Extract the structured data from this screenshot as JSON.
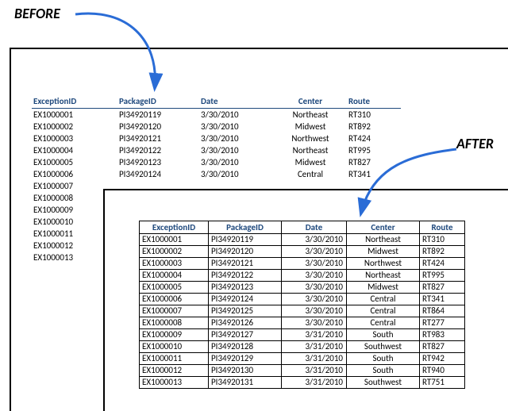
{
  "labels": {
    "before": "BEFORE",
    "after": "AFTER"
  },
  "columns": {
    "exception": "ExceptionID",
    "package": "PackageID",
    "date": "Date",
    "center": "Center",
    "route": "Route"
  },
  "before_rows": [
    {
      "exc": "EX1000001",
      "pkg": "PI34920119",
      "date": "3/30/2010",
      "ctr": "Northeast",
      "rt": "RT310"
    },
    {
      "exc": "EX1000002",
      "pkg": "PI34920120",
      "date": "3/30/2010",
      "ctr": "Midwest",
      "rt": "RT892"
    },
    {
      "exc": "EX1000003",
      "pkg": "PI34920121",
      "date": "3/30/2010",
      "ctr": "Northwest",
      "rt": "RT424"
    },
    {
      "exc": "EX1000004",
      "pkg": "PI34920122",
      "date": "3/30/2010",
      "ctr": "Northeast",
      "rt": "RT995"
    },
    {
      "exc": "EX1000005",
      "pkg": "PI34920123",
      "date": "3/30/2010",
      "ctr": "Midwest",
      "rt": "RT827"
    },
    {
      "exc": "EX1000006",
      "pkg": "PI34920124",
      "date": "3/30/2010",
      "ctr": "Central",
      "rt": "RT341"
    },
    {
      "exc": "EX1000007",
      "pkg": "",
      "date": "",
      "ctr": "",
      "rt": ""
    },
    {
      "exc": "EX1000008",
      "pkg": "",
      "date": "",
      "ctr": "",
      "rt": ""
    },
    {
      "exc": "EX1000009",
      "pkg": "",
      "date": "",
      "ctr": "",
      "rt": ""
    },
    {
      "exc": "EX1000010",
      "pkg": "",
      "date": "",
      "ctr": "",
      "rt": ""
    },
    {
      "exc": "EX1000011",
      "pkg": "",
      "date": "",
      "ctr": "",
      "rt": ""
    },
    {
      "exc": "EX1000012",
      "pkg": "",
      "date": "",
      "ctr": "",
      "rt": ""
    },
    {
      "exc": "EX1000013",
      "pkg": "",
      "date": "",
      "ctr": "",
      "rt": ""
    }
  ],
  "after_rows": [
    {
      "exc": "EX1000001",
      "pkg": "PI34920119",
      "date": "3/30/2010",
      "ctr": "Northeast",
      "rt": "RT310"
    },
    {
      "exc": "EX1000002",
      "pkg": "PI34920120",
      "date": "3/30/2010",
      "ctr": "Midwest",
      "rt": "RT892"
    },
    {
      "exc": "EX1000003",
      "pkg": "PI34920121",
      "date": "3/30/2010",
      "ctr": "Northwest",
      "rt": "RT424"
    },
    {
      "exc": "EX1000004",
      "pkg": "PI34920122",
      "date": "3/30/2010",
      "ctr": "Northeast",
      "rt": "RT995"
    },
    {
      "exc": "EX1000005",
      "pkg": "PI34920123",
      "date": "3/30/2010",
      "ctr": "Midwest",
      "rt": "RT827"
    },
    {
      "exc": "EX1000006",
      "pkg": "PI34920124",
      "date": "3/30/2010",
      "ctr": "Central",
      "rt": "RT341"
    },
    {
      "exc": "EX1000007",
      "pkg": "PI34920125",
      "date": "3/30/2010",
      "ctr": "Central",
      "rt": "RT864"
    },
    {
      "exc": "EX1000008",
      "pkg": "PI34920126",
      "date": "3/30/2010",
      "ctr": "Central",
      "rt": "RT277"
    },
    {
      "exc": "EX1000009",
      "pkg": "PI34920127",
      "date": "3/31/2010",
      "ctr": "South",
      "rt": "RT983"
    },
    {
      "exc": "EX1000010",
      "pkg": "PI34920128",
      "date": "3/31/2010",
      "ctr": "Southwest",
      "rt": "RT827"
    },
    {
      "exc": "EX1000011",
      "pkg": "PI34920129",
      "date": "3/31/2010",
      "ctr": "South",
      "rt": "RT942"
    },
    {
      "exc": "EX1000012",
      "pkg": "PI34920130",
      "date": "3/31/2010",
      "ctr": "South",
      "rt": "RT940"
    },
    {
      "exc": "EX1000013",
      "pkg": "PI34920131",
      "date": "3/31/2010",
      "ctr": "Southwest",
      "rt": "RT751"
    }
  ]
}
